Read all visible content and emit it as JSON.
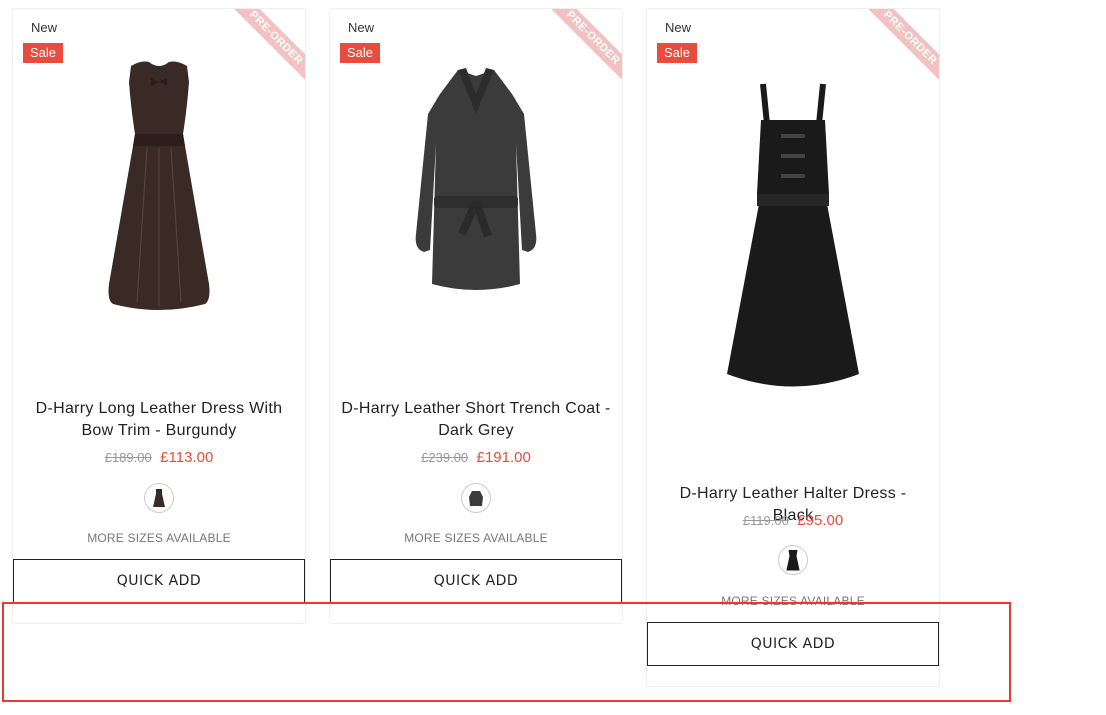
{
  "products": [
    {
      "badge_new": "New",
      "badge_sale": "Sale",
      "ribbon": "PRE-ORDER",
      "title": "D-Harry Long Leather Dress With Bow Trim - Burgundy",
      "price_old": "£189.00",
      "price_new": "£113.00",
      "more_sizes": "MORE SIZES AVAILABLE",
      "quick_add": "QUICK ADD",
      "color": "#3a2a25"
    },
    {
      "badge_new": "New",
      "badge_sale": "Sale",
      "ribbon": "PRE-ORDER",
      "title": "D-Harry Leather Short Trench Coat - Dark Grey",
      "price_old": "£239.00",
      "price_new": "£191.00",
      "more_sizes": "MORE SIZES AVAILABLE",
      "quick_add": "QUICK ADD",
      "color": "#3b3b3b"
    },
    {
      "badge_new": "New",
      "badge_sale": "Sale",
      "ribbon": "PRE-ORDER",
      "title": "D-Harry Leather Halter Dress - Black",
      "price_old": "£119.00",
      "price_new": "£95.00",
      "more_sizes": "MORE SIZES AVAILABLE",
      "quick_add": "QUICK ADD",
      "color": "#1a1a1a"
    }
  ],
  "colors": {
    "sale": "#e74c3c",
    "ribbon": "#f2c1c1",
    "highlight": "#e53935"
  }
}
